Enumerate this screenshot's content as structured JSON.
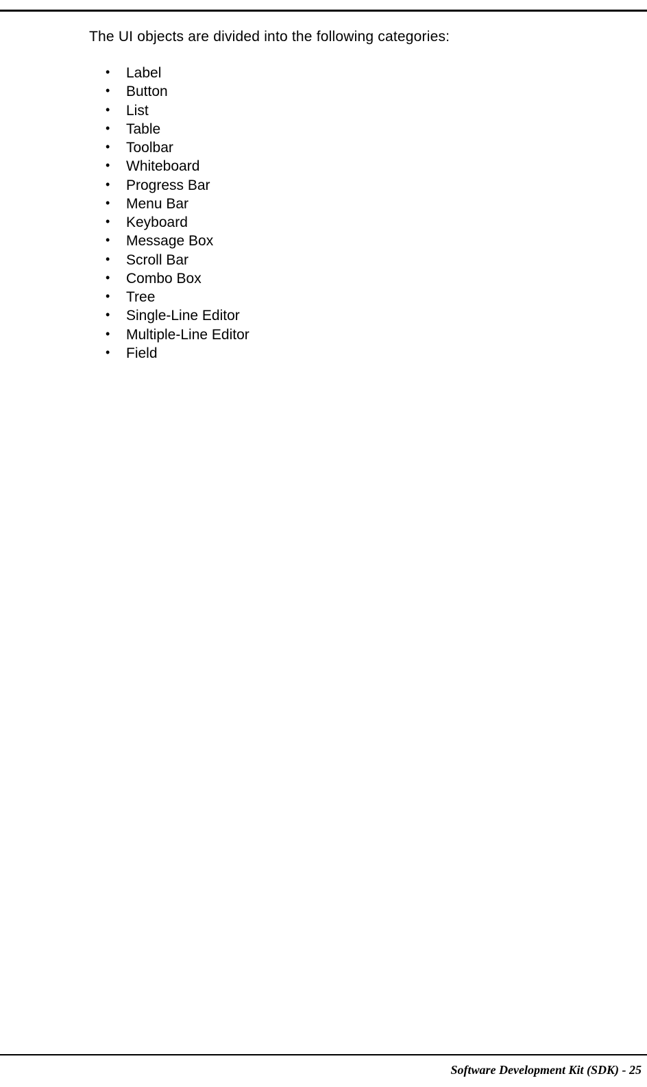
{
  "intro": "The UI objects are divided into the following categories:",
  "items": [
    "Label",
    "Button",
    "List",
    "Table",
    "Toolbar",
    "Whiteboard",
    "Progress Bar",
    "Menu Bar",
    "Keyboard",
    "Message Box",
    "Scroll Bar",
    "Combo Box",
    "Tree",
    "Single-Line Editor",
    "Multiple-Line Editor",
    "Field"
  ],
  "footer": "Software Development Kit (SDK) - 25"
}
